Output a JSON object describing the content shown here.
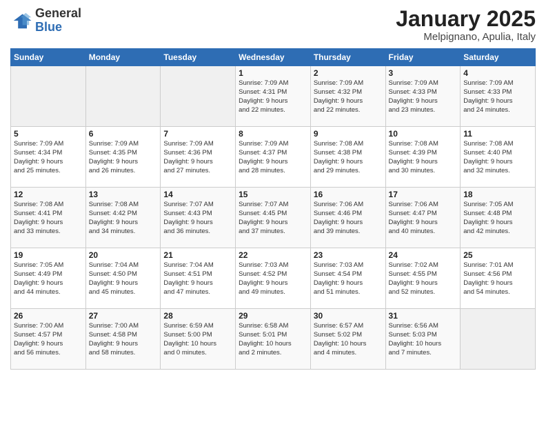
{
  "logo": {
    "general": "General",
    "blue": "Blue"
  },
  "header": {
    "month": "January 2025",
    "location": "Melpignano, Apulia, Italy"
  },
  "weekdays": [
    "Sunday",
    "Monday",
    "Tuesday",
    "Wednesday",
    "Thursday",
    "Friday",
    "Saturday"
  ],
  "weeks": [
    [
      {
        "day": "",
        "content": ""
      },
      {
        "day": "",
        "content": ""
      },
      {
        "day": "",
        "content": ""
      },
      {
        "day": "1",
        "content": "Sunrise: 7:09 AM\nSunset: 4:31 PM\nDaylight: 9 hours\nand 22 minutes."
      },
      {
        "day": "2",
        "content": "Sunrise: 7:09 AM\nSunset: 4:32 PM\nDaylight: 9 hours\nand 22 minutes."
      },
      {
        "day": "3",
        "content": "Sunrise: 7:09 AM\nSunset: 4:33 PM\nDaylight: 9 hours\nand 23 minutes."
      },
      {
        "day": "4",
        "content": "Sunrise: 7:09 AM\nSunset: 4:33 PM\nDaylight: 9 hours\nand 24 minutes."
      }
    ],
    [
      {
        "day": "5",
        "content": "Sunrise: 7:09 AM\nSunset: 4:34 PM\nDaylight: 9 hours\nand 25 minutes."
      },
      {
        "day": "6",
        "content": "Sunrise: 7:09 AM\nSunset: 4:35 PM\nDaylight: 9 hours\nand 26 minutes."
      },
      {
        "day": "7",
        "content": "Sunrise: 7:09 AM\nSunset: 4:36 PM\nDaylight: 9 hours\nand 27 minutes."
      },
      {
        "day": "8",
        "content": "Sunrise: 7:09 AM\nSunset: 4:37 PM\nDaylight: 9 hours\nand 28 minutes."
      },
      {
        "day": "9",
        "content": "Sunrise: 7:08 AM\nSunset: 4:38 PM\nDaylight: 9 hours\nand 29 minutes."
      },
      {
        "day": "10",
        "content": "Sunrise: 7:08 AM\nSunset: 4:39 PM\nDaylight: 9 hours\nand 30 minutes."
      },
      {
        "day": "11",
        "content": "Sunrise: 7:08 AM\nSunset: 4:40 PM\nDaylight: 9 hours\nand 32 minutes."
      }
    ],
    [
      {
        "day": "12",
        "content": "Sunrise: 7:08 AM\nSunset: 4:41 PM\nDaylight: 9 hours\nand 33 minutes."
      },
      {
        "day": "13",
        "content": "Sunrise: 7:08 AM\nSunset: 4:42 PM\nDaylight: 9 hours\nand 34 minutes."
      },
      {
        "day": "14",
        "content": "Sunrise: 7:07 AM\nSunset: 4:43 PM\nDaylight: 9 hours\nand 36 minutes."
      },
      {
        "day": "15",
        "content": "Sunrise: 7:07 AM\nSunset: 4:45 PM\nDaylight: 9 hours\nand 37 minutes."
      },
      {
        "day": "16",
        "content": "Sunrise: 7:06 AM\nSunset: 4:46 PM\nDaylight: 9 hours\nand 39 minutes."
      },
      {
        "day": "17",
        "content": "Sunrise: 7:06 AM\nSunset: 4:47 PM\nDaylight: 9 hours\nand 40 minutes."
      },
      {
        "day": "18",
        "content": "Sunrise: 7:05 AM\nSunset: 4:48 PM\nDaylight: 9 hours\nand 42 minutes."
      }
    ],
    [
      {
        "day": "19",
        "content": "Sunrise: 7:05 AM\nSunset: 4:49 PM\nDaylight: 9 hours\nand 44 minutes."
      },
      {
        "day": "20",
        "content": "Sunrise: 7:04 AM\nSunset: 4:50 PM\nDaylight: 9 hours\nand 45 minutes."
      },
      {
        "day": "21",
        "content": "Sunrise: 7:04 AM\nSunset: 4:51 PM\nDaylight: 9 hours\nand 47 minutes."
      },
      {
        "day": "22",
        "content": "Sunrise: 7:03 AM\nSunset: 4:52 PM\nDaylight: 9 hours\nand 49 minutes."
      },
      {
        "day": "23",
        "content": "Sunrise: 7:03 AM\nSunset: 4:54 PM\nDaylight: 9 hours\nand 51 minutes."
      },
      {
        "day": "24",
        "content": "Sunrise: 7:02 AM\nSunset: 4:55 PM\nDaylight: 9 hours\nand 52 minutes."
      },
      {
        "day": "25",
        "content": "Sunrise: 7:01 AM\nSunset: 4:56 PM\nDaylight: 9 hours\nand 54 minutes."
      }
    ],
    [
      {
        "day": "26",
        "content": "Sunrise: 7:00 AM\nSunset: 4:57 PM\nDaylight: 9 hours\nand 56 minutes."
      },
      {
        "day": "27",
        "content": "Sunrise: 7:00 AM\nSunset: 4:58 PM\nDaylight: 9 hours\nand 58 minutes."
      },
      {
        "day": "28",
        "content": "Sunrise: 6:59 AM\nSunset: 5:00 PM\nDaylight: 10 hours\nand 0 minutes."
      },
      {
        "day": "29",
        "content": "Sunrise: 6:58 AM\nSunset: 5:01 PM\nDaylight: 10 hours\nand 2 minutes."
      },
      {
        "day": "30",
        "content": "Sunrise: 6:57 AM\nSunset: 5:02 PM\nDaylight: 10 hours\nand 4 minutes."
      },
      {
        "day": "31",
        "content": "Sunrise: 6:56 AM\nSunset: 5:03 PM\nDaylight: 10 hours\nand 7 minutes."
      },
      {
        "day": "",
        "content": ""
      }
    ]
  ]
}
